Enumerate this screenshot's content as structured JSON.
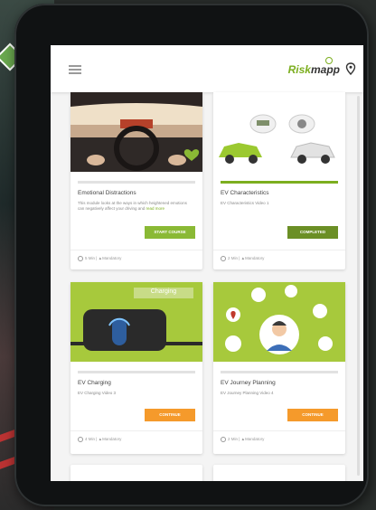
{
  "app": {
    "logo_risk": "Risk",
    "logo_mapp": "mapp"
  },
  "cards": [
    {
      "title": "Emotional Distractions",
      "description": "This module looks at the ways in which heightened emotions can negatively affect your driving and ",
      "read_more": "read more",
      "button": "START COURSE",
      "button_color": "#8ab935",
      "progress": 0,
      "duration": "5 Min",
      "tag": "Mandatory"
    },
    {
      "title": "EV Characteristics",
      "description": "EV Characteristics Video 1",
      "button": "COMPLETED",
      "button_color": "#6b8f25",
      "progress": 1,
      "duration": "2 Min",
      "tag": "Mandatory"
    },
    {
      "title": "EV Charging",
      "description": "EV Charging Video 3",
      "button": "CONTINUE",
      "button_color": "#f59a2b",
      "progress": 0,
      "image_label": "Charging",
      "duration": "4 Min",
      "tag": "Mandatory"
    },
    {
      "title": "EV Journey Planning",
      "description": "EV Journey Planning Video 4",
      "button": "CONTINUE",
      "button_color": "#f59a2b",
      "progress": 0,
      "duration": "2 Min",
      "tag": "Mandatory"
    }
  ]
}
